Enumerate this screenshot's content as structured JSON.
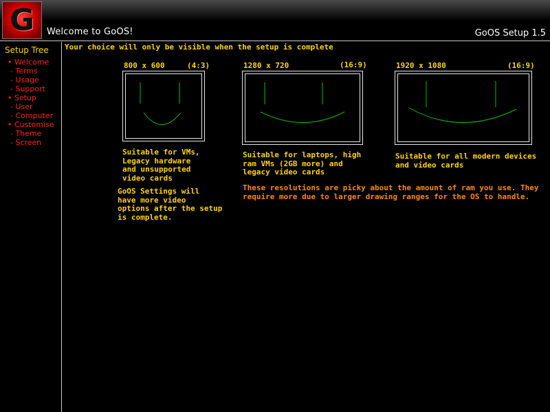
{
  "header": {
    "logo_letter": "G",
    "title": "Welcome to GoOS!",
    "version": "GoOS Setup 1.5"
  },
  "sidebar": {
    "title": "Setup Tree",
    "items": [
      {
        "label": "• Welcome",
        "level": 0
      },
      {
        "label": "- Terms",
        "level": 1
      },
      {
        "label": "- Usage",
        "level": 1
      },
      {
        "label": "- Support",
        "level": 1
      },
      {
        "label": "• Setup",
        "level": 0
      },
      {
        "label": "- User",
        "level": 1
      },
      {
        "label": "- Computer",
        "level": 1
      },
      {
        "label": "• Customise",
        "level": 0
      },
      {
        "label": "- Theme",
        "level": 1
      },
      {
        "label": "- Screen",
        "level": 1
      }
    ]
  },
  "main": {
    "notice": "Your choice will only be visible when the setup is complete",
    "options": [
      {
        "resolution": "800 x 600",
        "aspect": "(4:3)",
        "description": [
          "Suitable for VMs,",
          "Legacy hardware",
          "and unsupported",
          "video cards"
        ]
      },
      {
        "resolution": "1280 x 720",
        "aspect": "(16:9)",
        "description": [
          "Suitable for laptops, high",
          "ram VMs (2GB more) and",
          "legacy video cards"
        ]
      },
      {
        "resolution": "1920 x 1080",
        "aspect": "(16:9)",
        "description": [
          "Suitable for all modern devices",
          "and video cards"
        ]
      }
    ],
    "settings_note": [
      "GoOS Settings will",
      "have more video",
      "options after the setup",
      "is complete."
    ],
    "warning": [
      "These resolutions are picky about the amount of ram you use. They",
      "require more due to larger drawing ranges for the OS to handle."
    ]
  },
  "colors": {
    "accent_yellow": "#ffd400",
    "tree_red": "#ff2020",
    "warning_orange": "#ff8a00",
    "face_green": "#00c000"
  }
}
